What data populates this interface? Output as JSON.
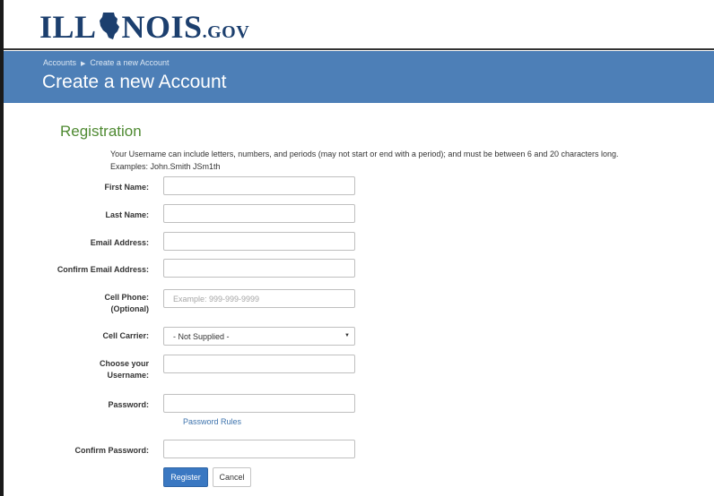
{
  "header": {
    "logo_text_left": "ILL",
    "logo_text_right": "NOIS",
    "logo_suffix": ".GOV"
  },
  "banner": {
    "breadcrumb": [
      "Accounts",
      "Create a new Account"
    ],
    "title": "Create a new Account"
  },
  "form": {
    "section_title": "Registration",
    "hint_line1": "Your Username can include letters, numbers, and periods (may not start or end with a period); and must be between 6 and 20 characters long.",
    "hint_line2": "Examples: John.Smith JSm1th",
    "first_name_label": "First Name:",
    "last_name_label": "Last Name:",
    "email_label": "Email Address:",
    "confirm_email_label": "Confirm Email Address:",
    "cell_phone_label_1": "Cell Phone:",
    "cell_phone_label_2": "(Optional)",
    "cell_phone_placeholder": "Example: 999-999-9999",
    "cell_carrier_label": "Cell Carrier:",
    "cell_carrier_value": "- Not Supplied -",
    "username_label_1": "Choose your",
    "username_label_2": "Username:",
    "password_label": "Password:",
    "password_rules_link": "Password Rules",
    "confirm_password_label": "Confirm Password:",
    "register_button": "Register",
    "cancel_button": "Cancel"
  },
  "colors": {
    "banner": "#4d7fb7",
    "section_title": "#4f8a32",
    "primary_button": "#3a78c2",
    "logo": "#1c3f6e"
  },
  "icons": {
    "breadcrumb_separator": "caret-right-icon",
    "select_caret": "caret-down-icon",
    "logo_mark": "illinois-state-shape-icon"
  }
}
